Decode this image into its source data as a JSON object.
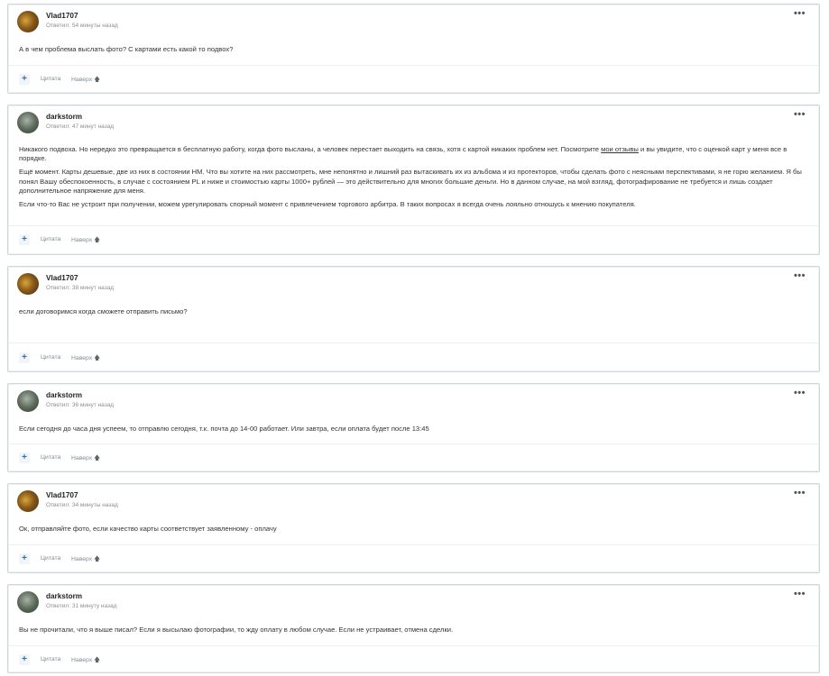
{
  "posts": [
    {
      "author": "Vlad1707",
      "meta": "Ответил: 54 минуты назад",
      "avatar": "vlad",
      "paragraphs": [
        "А в чем проблема выслать фото? С картами есть какой то подвох?"
      ]
    },
    {
      "author": "darkstorm",
      "meta": "Ответил: 47 минут назад",
      "avatar": "dark",
      "p1_before": "Никакого подвоха. Но нередко это превращается в бесплатную работу, когда фото высланы, а человек перестает выходить на связь, хотя с картой никаких проблем нет. Посмотрите ",
      "p1_link": "мои отзывы",
      "p1_after": " и вы увидите, что с оценкой карт у меня все в порядке.",
      "paragraphs": [
        "Ещё момент. Карты дешевые, две из них в состоянии НМ. Что вы хотите на них рассмотреть, мне непонятно и лишний раз вытаскивать их из альбома и из протекторов, чтобы сделать фото с неясными перспективами, я не горю желанием. Я бы понял Вашу обеспокоенность, в случае с состоянием PL и ниже и стоимостью карты 1000+ рублей — это действительно для многих большие деньги. Но в данном случае, на мой взгляд, фотографирование не требуется и лишь создает дополнительное напряжение для меня.",
        "Если что-то Вас не устроит при получении, можем урегулировать спорный момент с привлечением торгового арбитра. В таких вопросах я всегда очень лояльно отношусь к мнению покупателя."
      ]
    },
    {
      "author": "Vlad1707",
      "meta": "Ответил: 38 минут назад",
      "avatar": "vlad",
      "paragraphs": [
        "если договоримся когда сможете отправить письмо?"
      ]
    },
    {
      "author": "darkstorm",
      "meta": "Ответил: 36 минут назад",
      "avatar": "dark",
      "paragraphs": [
        "Если сегодня до часа дня успеем, то отправлю сегодня, т.к. почта до 14-00 работает. Или завтра, если оплата будет после 13:45"
      ]
    },
    {
      "author": "Vlad1707",
      "meta": "Ответил: 34 минуты назад",
      "avatar": "vlad",
      "paragraphs": [
        "Ок, отправляйте фото, если качество карты соответствует заявленному - оплачу"
      ]
    },
    {
      "author": "darkstorm",
      "meta": "Ответил: 31 минуту назад",
      "avatar": "dark",
      "paragraphs": [
        "Вы не прочитали, что я выше писал? Если я высылаю фотографии, то жду оплату в любом случае. Если не устраивает, отмена сделки."
      ]
    }
  ],
  "labels": {
    "menu": "•••",
    "plus": "+",
    "quote": "Цитата",
    "top": "Наверх",
    "top_arrow": "🡅"
  }
}
